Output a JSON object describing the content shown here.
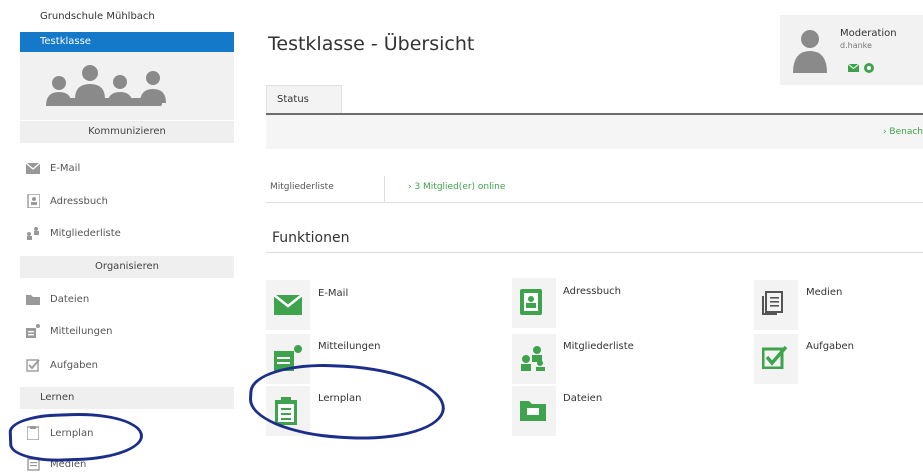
{
  "sidebar": {
    "school_name": "Grundschule Mühlbach",
    "class_name": "Testklasse",
    "sections": {
      "communicate": "Kommunizieren",
      "organize": "Organisieren",
      "learn": "Lernen"
    },
    "items": [
      {
        "label": "E-Mail",
        "icon": "mail-icon"
      },
      {
        "label": "Adressbuch",
        "icon": "addressbook-icon"
      },
      {
        "label": "Mitgliederliste",
        "icon": "members-icon"
      },
      {
        "label": "Dateien",
        "icon": "folder-icon"
      },
      {
        "label": "Mitteilungen",
        "icon": "message-icon"
      },
      {
        "label": "Aufgaben",
        "icon": "checkbox-icon"
      },
      {
        "label": "Lernplan",
        "icon": "clipboard-icon"
      },
      {
        "label": "Medien",
        "icon": "media-icon"
      }
    ]
  },
  "main": {
    "title": "Testklasse - Übersicht",
    "tab": "Status",
    "status_link": "› Benach",
    "members": {
      "label": "Mitgliederliste",
      "online": "› 3 Mitglied(er) online"
    },
    "functions_heading": "Funktionen",
    "functions": [
      {
        "label": "E-Mail",
        "icon": "mail-icon"
      },
      {
        "label": "Adressbuch",
        "icon": "addressbook-icon"
      },
      {
        "label": "Medien",
        "icon": "media-icon"
      },
      {
        "label": "Mitteilungen",
        "icon": "message-icon"
      },
      {
        "label": "Mitgliederliste",
        "icon": "members-icon"
      },
      {
        "label": "Aufgaben",
        "icon": "checkbox-icon"
      },
      {
        "label": "Lernplan",
        "icon": "clipboard-icon"
      },
      {
        "label": "Dateien",
        "icon": "folder-icon"
      }
    ]
  },
  "moderation": {
    "title": "Moderation",
    "user": "d.hanke"
  },
  "colors": {
    "accent_blue": "#1479c9",
    "green": "#3fa34d",
    "scribble": "#1b2f8a"
  }
}
